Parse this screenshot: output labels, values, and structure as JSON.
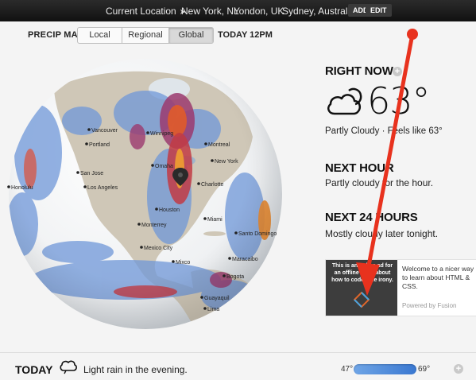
{
  "topbar": {
    "current_location": "Current Location",
    "locations": [
      "New York, NY",
      "London, UK",
      "Sydney, Australia"
    ],
    "add_label": "ADD",
    "edit_label": "EDIT"
  },
  "precip_map": {
    "label": "PRECIP MAP",
    "tabs": [
      "Local",
      "Regional",
      "Global"
    ],
    "selected_tab": "Global",
    "time_label": "TODAY 12PM"
  },
  "map": {
    "cities": [
      "Vancouver",
      "Winnipeg",
      "Portland",
      "Montreal",
      "Omaha",
      "New York",
      "San Jose",
      "Honolulu",
      "Los Angeles",
      "Charlotte",
      "Houston",
      "Miami",
      "Monterrey",
      "Santo Domingo",
      "Mexico City",
      "Mixco",
      "Maracaibo",
      "Bogota",
      "Guayaquil",
      "Lima"
    ]
  },
  "right_now": {
    "title": "RIGHT NOW",
    "temperature": "63°",
    "condition": "Partly Cloudy · Feels like 63°"
  },
  "next_hour": {
    "title": "NEXT HOUR",
    "text": "Partly cloudy for the hour."
  },
  "next_24": {
    "title": "NEXT 24 HOURS",
    "text": "Mostly cloudy later tonight."
  },
  "ad": {
    "image_text": "This is an online ad for an offline book about how to code. The irony.",
    "text": "Welcome to a nicer way to learn about HTML & CSS.",
    "powered": "Powered by Fusion"
  },
  "today": {
    "title": "TODAY",
    "text": "Light rain in the evening.",
    "low": "47°",
    "high": "69°"
  },
  "colors": {
    "topbar": "#1a1a1a",
    "annotation_arrow": "#e8321e",
    "temp_bar": "#3a78d1"
  }
}
